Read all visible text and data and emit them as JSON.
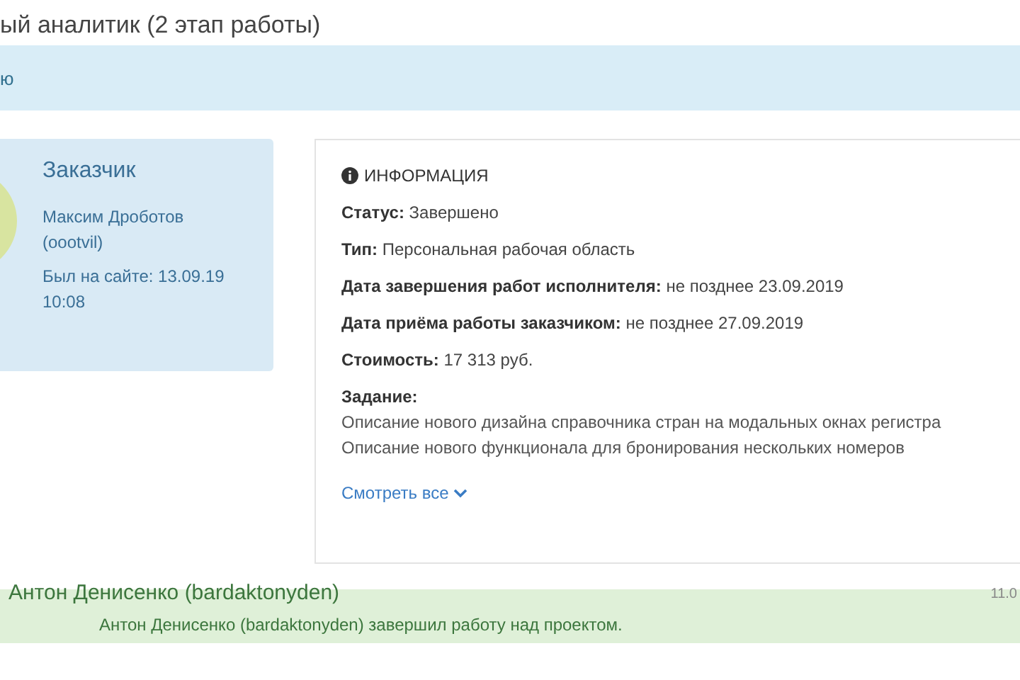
{
  "page_title": "ый аналитик (2 этап работы)",
  "banner": {
    "text": "ю"
  },
  "customer": {
    "heading": "Заказчик",
    "name": "Максим Дроботов",
    "login": "(oootvil)",
    "last_seen": "Был на сайте: 13.09.19 10:08"
  },
  "info": {
    "heading": "ИНФОРМАЦИЯ",
    "fields": [
      {
        "label": "Статус:",
        "value": "Завершено"
      },
      {
        "label": "Тип:",
        "value": "Персональная рабочая область"
      },
      {
        "label": "Дата завершения работ исполнителя:",
        "value": "не позднее 23.09.2019"
      },
      {
        "label": "Дата приёма работы заказчиком:",
        "value": "не позднее 27.09.2019"
      },
      {
        "label": "Стоимость:",
        "value": "17 313 руб."
      }
    ],
    "task_label": "Задание:",
    "task_lines": [
      "Описание нового дизайна справочника стран на модальных окнах регистра",
      "Описание нового функционала для бронирования нескольких номеров"
    ],
    "more_link": "Смотреть все"
  },
  "event": {
    "author": "Антон Денисенко (bardaktonyden)",
    "date": "11.0",
    "message": "Антон Денисенко (bardaktonyden) завершил работу над проектом."
  }
}
